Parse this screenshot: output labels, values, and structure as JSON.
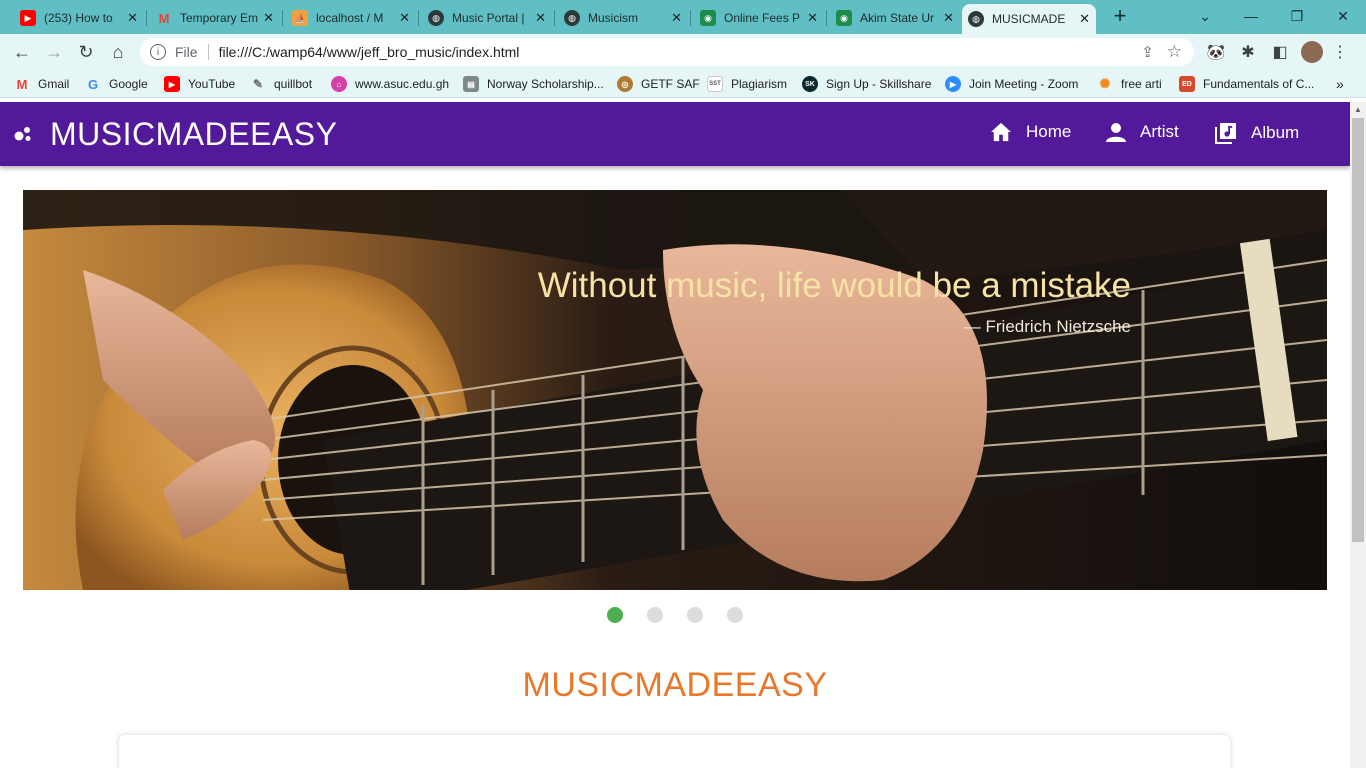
{
  "browser": {
    "tabs": [
      {
        "title": "(253) How to",
        "icon": "youtube-icon",
        "color": "#ff0000"
      },
      {
        "title": "Temporary Em",
        "icon": "gmail-icon",
        "color": "#ea4335"
      },
      {
        "title": "localhost / M",
        "icon": "phpmyadmin-icon",
        "color": "#f0a23c"
      },
      {
        "title": "Music Portal |",
        "icon": "globe-icon",
        "color": "#2d3a3b"
      },
      {
        "title": "Musicism",
        "icon": "globe-icon",
        "color": "#2d3a3b"
      },
      {
        "title": "Online Fees P",
        "icon": "fees-icon",
        "color": "#1e8c4a"
      },
      {
        "title": "Akim State Ur",
        "icon": "university-icon",
        "color": "#1e8c4a"
      },
      {
        "title": "MUSICMADE",
        "icon": "globe-icon",
        "color": "#2d3a3b",
        "active": true
      }
    ],
    "address": {
      "scheme_label": "File",
      "url": "file:///C:/wamp64/www/jeff_bro_music/index.html"
    },
    "bookmarks": [
      {
        "label": "Gmail",
        "icon": "gmail-icon",
        "color": "#ea4335"
      },
      {
        "label": "Google",
        "icon": "google-icon",
        "color": "#4285f4"
      },
      {
        "label": "YouTube",
        "icon": "youtube-icon",
        "color": "#ff0000"
      },
      {
        "label": "quillbot",
        "icon": "quill-icon",
        "color": "#6b6b6b"
      },
      {
        "label": "www.asuc.edu.gh",
        "icon": "asuc-icon",
        "color": "#d63fa8"
      },
      {
        "label": "Norway Scholarship...",
        "icon": "doc-icon",
        "color": "#7d8a8b"
      },
      {
        "label": "GETF SAF",
        "icon": "getf-icon",
        "color": "#b07a2f"
      },
      {
        "label": "Plagiarism",
        "icon": "sst-icon",
        "color": "#9aa0a6"
      },
      {
        "label": "Sign Up - Skillshare",
        "icon": "skillshare-icon",
        "color": "#0a2a2f"
      },
      {
        "label": "Join Meeting - Zoom",
        "icon": "zoom-icon",
        "color": "#2d8cff"
      },
      {
        "label": "free arti",
        "icon": "free-art-icon",
        "color": "#f28b1b"
      },
      {
        "label": "Fundamentals of C...",
        "icon": "ed-icon",
        "color": "#d9472b"
      }
    ]
  },
  "site": {
    "brand": "MUSICMADEEASY",
    "nav": [
      {
        "label": "Home",
        "icon": "home-icon"
      },
      {
        "label": "Artist",
        "icon": "person-icon"
      },
      {
        "label": "Album",
        "icon": "album-icon"
      }
    ],
    "hero": {
      "quote": "Without music, life would be a mistake",
      "author": "— Friedrich Nietzsche",
      "slides": 4,
      "active_slide": 1
    },
    "section_title": "MUSICMADEEASY",
    "colors": {
      "navbar": "#52199a",
      "accent": "#e8782a",
      "active_dot": "#4cae4f"
    }
  }
}
